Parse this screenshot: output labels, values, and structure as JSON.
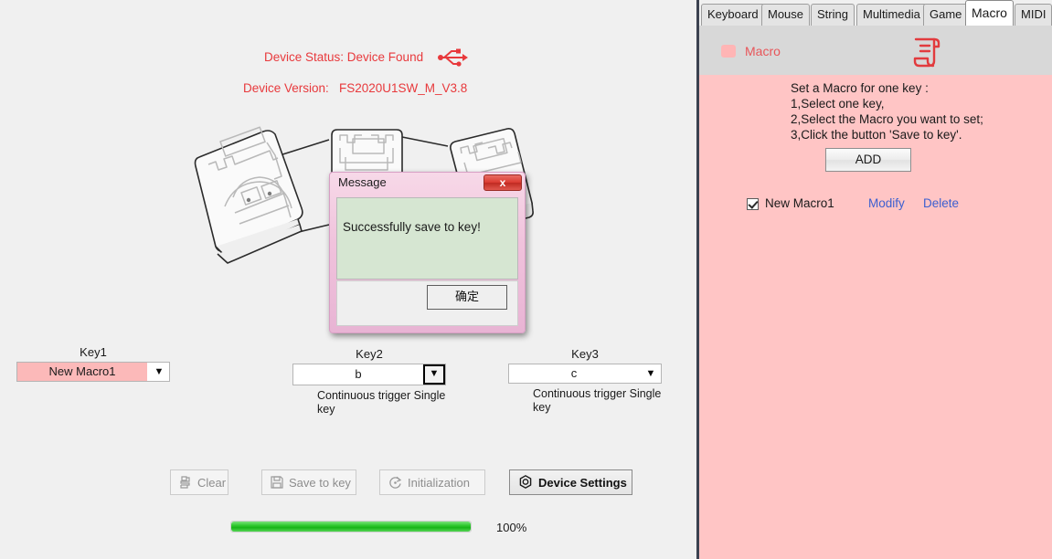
{
  "left": {
    "device_status": "Device Status: Device Found",
    "device_version_label": "Device Version:",
    "device_version_value": "FS2020U1SW_M_V3.8",
    "usb_icon": "usb-icon",
    "illustration": "key-cards-illustration"
  },
  "dialog": {
    "title": "Message",
    "message": "Successfully save to key!",
    "ok_label": "确定",
    "close_label": "x",
    "close_icon": "close-icon"
  },
  "keys": [
    {
      "label": "Key1",
      "value": "New Macro1",
      "arrow": "▼",
      "note": "",
      "highlighted": true,
      "focused": false
    },
    {
      "label": "Key2",
      "value": "b",
      "arrow": "▼",
      "note": "Continuous trigger\nSingle key",
      "highlighted": false,
      "focused": true
    },
    {
      "label": "Key3",
      "value": "c",
      "arrow": "▼",
      "note": "Continuous trigger\nSingle key",
      "highlighted": false,
      "focused": false
    }
  ],
  "toolbar": {
    "clear_label": "Clear",
    "save_to_key_label": "Save to key",
    "initialization_label": "Initialization",
    "device_settings_label": "Device Settings",
    "clear_icon": "brush-icon",
    "save_icon": "floppy-disk-icon",
    "initialization_icon": "refresh-icon",
    "device_settings_icon": "gear-nut-icon"
  },
  "progress": {
    "percent_label": "100%",
    "percent": 100,
    "fill_color": "#2ec82e"
  },
  "tabs": [
    {
      "label": "Keyboard",
      "active": false
    },
    {
      "label": "Mouse",
      "active": false
    },
    {
      "label": "String",
      "active": false
    },
    {
      "label": "Multimedia",
      "active": false
    },
    {
      "label": "Game",
      "active": false
    },
    {
      "label": "Macro",
      "active": true
    },
    {
      "label": "MIDI",
      "active": false
    }
  ],
  "right": {
    "header_title": "Macro",
    "header_swatch_icon": "macro-swatch-icon",
    "header_scroll_icon": "scroll-document-icon",
    "instructions": "Set a Macro for one key :\n1,Select one key,\n2,Select the Macro you want to set;\n3,Click the button 'Save to key'.",
    "add_label": "ADD",
    "macro_name": "New Macro1",
    "macro_checked": true,
    "modify_label": "Modify",
    "delete_label": "Delete",
    "panel_bg": "#ffc5c5",
    "accent": "#e8565a",
    "link_color": "#3c5fd0"
  }
}
